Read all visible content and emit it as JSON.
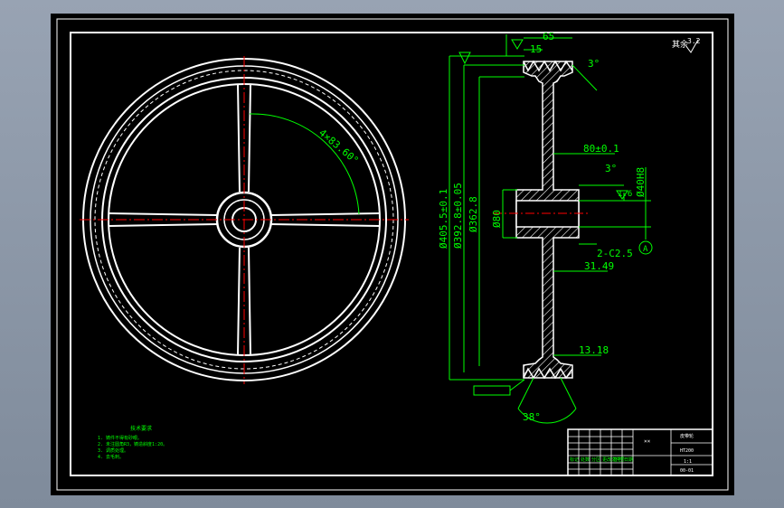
{
  "colors": {
    "background": "#000000",
    "outline": "#ffffff",
    "centerline": "#ff0000",
    "dimension": "#00ff00",
    "frame_bg_outer": "#8a96a6"
  },
  "front_view": {
    "spoke_angle_note": "4×83.60°"
  },
  "section_view": {
    "dims": {
      "top_width": "65",
      "groove_offset": "15",
      "groove_angle_top": "3°",
      "hub_bore_depth": "80±0.1",
      "hub_angle": "3°",
      "bore_fit": "Ø40H8",
      "od": "Ø405.5±0.1",
      "pitch_dia": "Ø392.8±0.05",
      "rim_inner": "Ø362.8",
      "hub_dia": "Ø80",
      "chamfer": "2-C2.5",
      "hub_len": "31.49",
      "web_pos": "13.18",
      "groove_angle": "38°",
      "runout_tol": "1.6",
      "datum": "A",
      "roughness_top": "3.2",
      "roughness_right": "1.6"
    },
    "symbols": {
      "surface_mark_left": "▽"
    }
  },
  "top_right_label": "其余",
  "notes": {
    "title": "技术要求",
    "lines": [
      "1. 铸件不得有砂眼。",
      "2. 未注圆角R3，铸造斜度1:20。",
      "3. 调质处理。",
      "4. 去毛刺。"
    ]
  },
  "title_block": {
    "part_name": "皮带轮",
    "material": "HT200",
    "scale": "1:1",
    "drawing_no": "00-01",
    "row_labels": [
      "标记",
      "处数",
      "分区",
      "更改文件号",
      "签名",
      "日期"
    ]
  }
}
